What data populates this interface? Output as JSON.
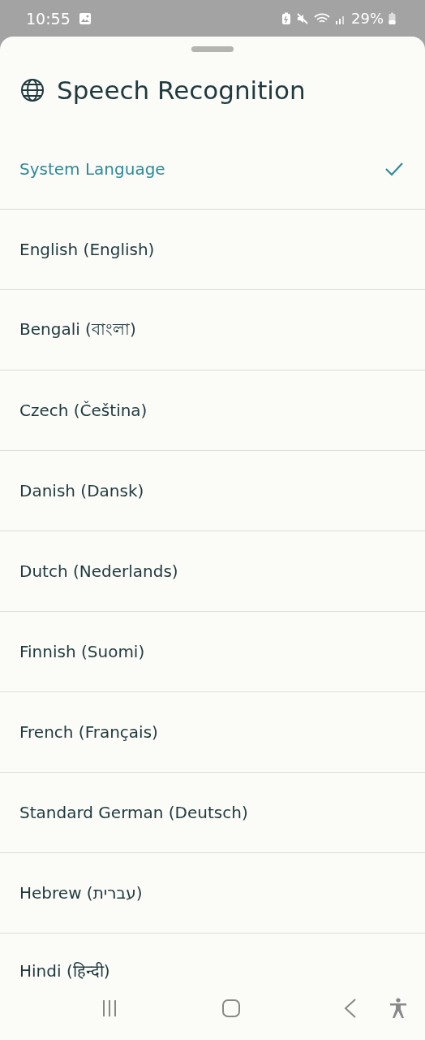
{
  "status_bar": {
    "time": "10:55",
    "battery": "29%"
  },
  "sheet": {
    "title": "Speech Recognition"
  },
  "languages": [
    {
      "label": "System Language",
      "selected": true
    },
    {
      "label": "English (English)",
      "selected": false
    },
    {
      "label": "Bengali (বাংলা)",
      "selected": false
    },
    {
      "label": "Czech (Čeština)",
      "selected": false
    },
    {
      "label": "Danish (Dansk)",
      "selected": false
    },
    {
      "label": "Dutch (Nederlands)",
      "selected": false
    },
    {
      "label": "Finnish (Suomi)",
      "selected": false
    },
    {
      "label": "French (Français)",
      "selected": false
    },
    {
      "label": "Standard German (Deutsch)",
      "selected": false
    },
    {
      "label": "Hebrew (עברית)",
      "selected": false
    },
    {
      "label": "Hindi (हिन्दी)",
      "selected": false
    }
  ]
}
